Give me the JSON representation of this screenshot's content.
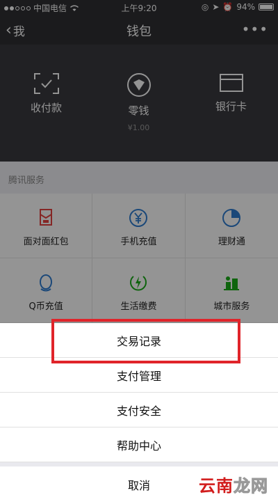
{
  "status_bar": {
    "carrier": "中国电信",
    "time": "上午9:20",
    "battery": "94%"
  },
  "nav": {
    "back_label": "我",
    "title": "钱包",
    "more": "•••"
  },
  "wallet": {
    "items": [
      {
        "label": "收付款",
        "icon": "scan-icon"
      },
      {
        "label": "零钱",
        "sub": "¥1.00",
        "icon": "coin-icon"
      },
      {
        "label": "银行卡",
        "icon": "card-icon"
      }
    ]
  },
  "services": {
    "title": "腾讯服务",
    "items": [
      {
        "label": "面对面红包",
        "icon": "red-envelope-icon",
        "color": "#e64340"
      },
      {
        "label": "手机充值",
        "icon": "yuan-circle-icon",
        "color": "#2f7dd1"
      },
      {
        "label": "理财通",
        "icon": "wealth-icon",
        "color": "#2f7dd1"
      },
      {
        "label": "Q币充值",
        "icon": "penguin-icon",
        "color": "#2f7dd1"
      },
      {
        "label": "生活缴费",
        "icon": "lightning-icon",
        "color": "#1aad19"
      },
      {
        "label": "城市服务",
        "icon": "city-icon",
        "color": "#1aad19"
      }
    ]
  },
  "action_sheet": {
    "items": [
      "交易记录",
      "支付管理",
      "支付安全",
      "帮助中心"
    ],
    "cancel": "取消"
  },
  "watermark": {
    "part1": "云南",
    "part2": "龙网"
  }
}
